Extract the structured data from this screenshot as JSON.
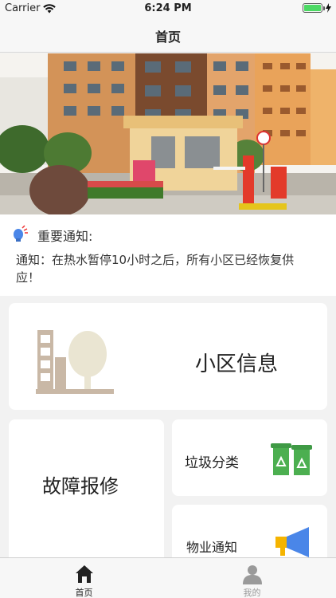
{
  "status_bar": {
    "carrier": "Carrier",
    "time": "6:24 PM"
  },
  "nav": {
    "title": "首页"
  },
  "notice": {
    "title": "重要通知:",
    "body": "通知：在热水暂停10小时之后，所有小区已经恢复供应！"
  },
  "cards": {
    "community_info": "小区信息",
    "repair": "故障报修",
    "garbage": "垃圾分类",
    "property_notice": "物业通知"
  },
  "tab_bar": {
    "items": [
      {
        "label": "首页",
        "icon": "home-icon",
        "active": true
      },
      {
        "label": "我的",
        "icon": "user-icon",
        "active": false
      }
    ]
  },
  "colors": {
    "battery": "#4cd964",
    "garbage_green": "#4caf50",
    "megaphone_blue": "#4a86e8",
    "megaphone_yellow": "#f5b400"
  }
}
